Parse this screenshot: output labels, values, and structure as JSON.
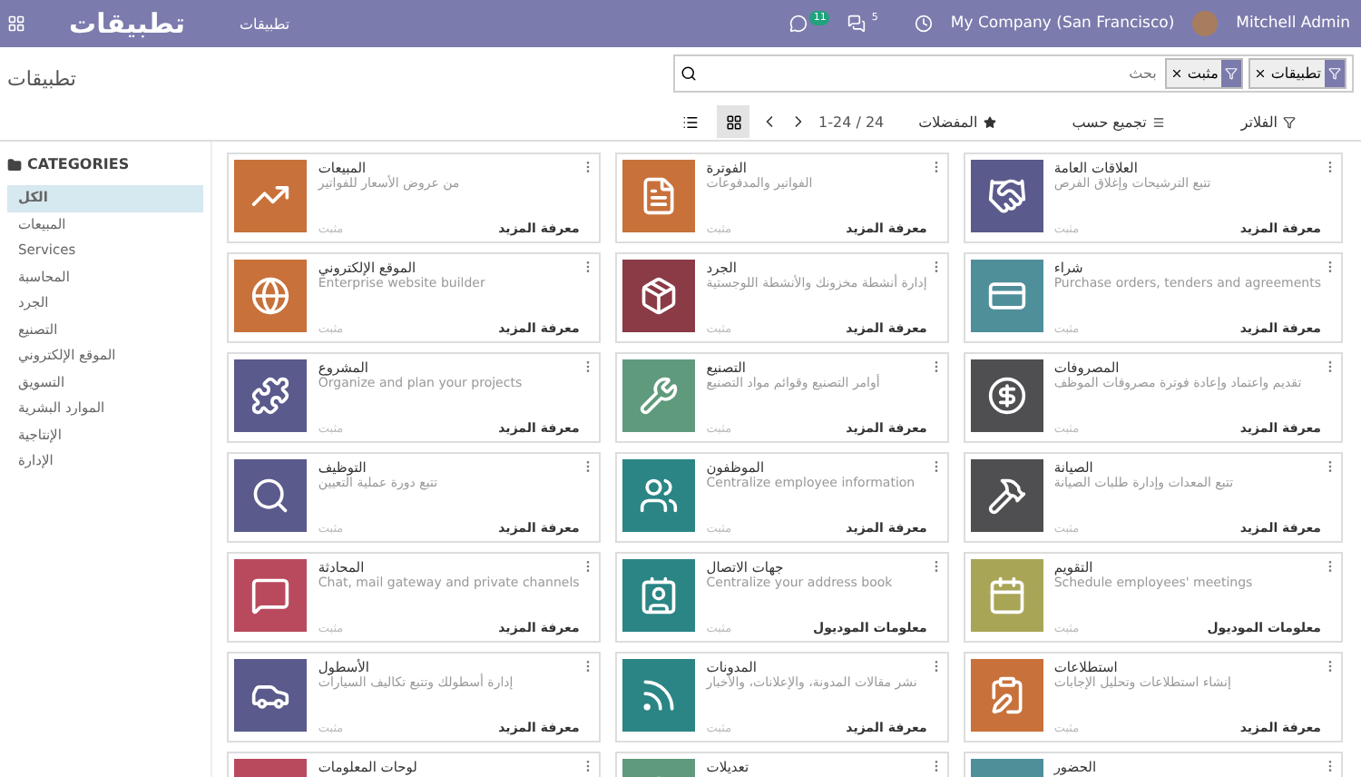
{
  "navbar": {
    "brand": "تطبيقات",
    "menu": [
      {
        "label": "تطبيقات"
      }
    ],
    "chat_badge": "11",
    "messages_badge": "5",
    "company": "My Company (San Francisco)",
    "user": "Mitchell Admin"
  },
  "control_panel": {
    "breadcrumb": "تطبيقات",
    "search": {
      "placeholder": "بحث",
      "facets": [
        {
          "label": "تطبيقات"
        },
        {
          "label": "مثبت"
        }
      ]
    },
    "buttons": [
      {
        "label": "الفلاتر",
        "kind": "filter"
      },
      {
        "label": "تجميع حسب",
        "kind": "group"
      },
      {
        "label": "المفضلات",
        "kind": "star"
      }
    ],
    "pager": "1-24 / 24",
    "views": [
      {
        "kind": "kanban",
        "selected": true
      },
      {
        "kind": "list",
        "selected": false
      }
    ]
  },
  "sidebar": {
    "title": "CATEGORIES",
    "items": [
      {
        "label": "الكل",
        "selected": true
      },
      {
        "label": "المبيعات",
        "selected": false
      },
      {
        "label": "Services",
        "selected": false
      },
      {
        "label": "المحاسبة",
        "selected": false
      },
      {
        "label": "الجرد",
        "selected": false
      },
      {
        "label": "التصنيع",
        "selected": false
      },
      {
        "label": "الموقع الإلكتروني",
        "selected": false
      },
      {
        "label": "التسويق",
        "selected": false
      },
      {
        "label": "الموارد البشرية",
        "selected": false
      },
      {
        "label": "الإنتاجية",
        "selected": false
      },
      {
        "label": "الإدارة",
        "selected": false
      }
    ]
  },
  "apps": [
    {
      "title": "العلاقات العامة",
      "description": "تتبع الترشيحات وإغلاق الفرص",
      "status": "مثبت",
      "button": "معرفة المزيد",
      "color": "#5b5a8c"
    },
    {
      "title": "الفوترة",
      "description": "الفواتير والمدفوعات",
      "status": "مثبت",
      "button": "معرفة المزيد",
      "color": "#c8713a"
    },
    {
      "title": "المبيعات",
      "description": "من عروض الأسعار للفواتير",
      "status": "مثبت",
      "button": "معرفة المزيد",
      "color": "#c8713a"
    },
    {
      "title": "شراء",
      "description": "Purchase orders, tenders and agreements",
      "status": "مثبت",
      "button": "معرفة المزيد",
      "color": "#4f8f9a"
    },
    {
      "title": "الجرد",
      "description": "إدارة أنشطة مخزونك والأنشطة اللوجستية",
      "status": "مثبت",
      "button": "معرفة المزيد",
      "color": "#8a3b45"
    },
    {
      "title": "الموقع الإلكتروني",
      "description": "Enterprise website builder",
      "status": "مثبت",
      "button": "معرفة المزيد",
      "color": "#c8713a"
    },
    {
      "title": "المصروفات",
      "description": "تقديم واعتماد وإعادة فوترة مصروفات الموظف",
      "status": "مثبت",
      "button": "معرفة المزيد",
      "color": "#4f4f52"
    },
    {
      "title": "التصنيع",
      "description": "أوامر التصنيع وقوائم مواد التصنيع",
      "status": "مثبت",
      "button": "معرفة المزيد",
      "color": "#5f9a7c"
    },
    {
      "title": "المشروع",
      "description": "Organize and plan your projects",
      "status": "مثبت",
      "button": "معرفة المزيد",
      "color": "#5b5a8c"
    },
    {
      "title": "الصيانة",
      "description": "تتبع المعدات وإدارة طلبات الصيانة",
      "status": "مثبت",
      "button": "معرفة المزيد",
      "color": "#4f4f52"
    },
    {
      "title": "الموظفون",
      "description": "Centralize employee information",
      "status": "مثبت",
      "button": "معرفة المزيد",
      "color": "#2b8585"
    },
    {
      "title": "التوظيف",
      "description": "تتبع دورة عملية التعيين",
      "status": "مثبت",
      "button": "معرفة المزيد",
      "color": "#5b5a8c"
    },
    {
      "title": "التقويم",
      "description": "Schedule employees' meetings",
      "status": "مثبت",
      "button": "معلومات الموديول",
      "color": "#a9a557"
    },
    {
      "title": "جهات الاتصال",
      "description": "Centralize your address book",
      "status": "مثبت",
      "button": "معلومات الموديول",
      "color": "#2b8585"
    },
    {
      "title": "المحادثة",
      "description": "Chat, mail gateway and private channels",
      "status": "مثبت",
      "button": "معرفة المزيد",
      "color": "#b94a5e"
    },
    {
      "title": "استطلاعات",
      "description": "إنشاء استطلاعات وتحليل الإجابات",
      "status": "مثبت",
      "button": "معرفة المزيد",
      "color": "#c8713a"
    },
    {
      "title": "المدونات",
      "description": "نشر مقالات المدونة، والإعلانات، والأخبار",
      "status": "مثبت",
      "button": "معرفة المزيد",
      "color": "#2b8585"
    },
    {
      "title": "الأسطول",
      "description": "إدارة أسطولك وتتبع تكاليف السيارات",
      "status": "مثبت",
      "button": "معرفة المزيد",
      "color": "#5b5a8c"
    },
    {
      "title": "الحضور",
      "color": "#4f8f9a"
    },
    {
      "title": "تعديلات",
      "color": "#5f9a7c"
    },
    {
      "title": "لوحات المعلومات",
      "color": "#b94a5e"
    }
  ]
}
